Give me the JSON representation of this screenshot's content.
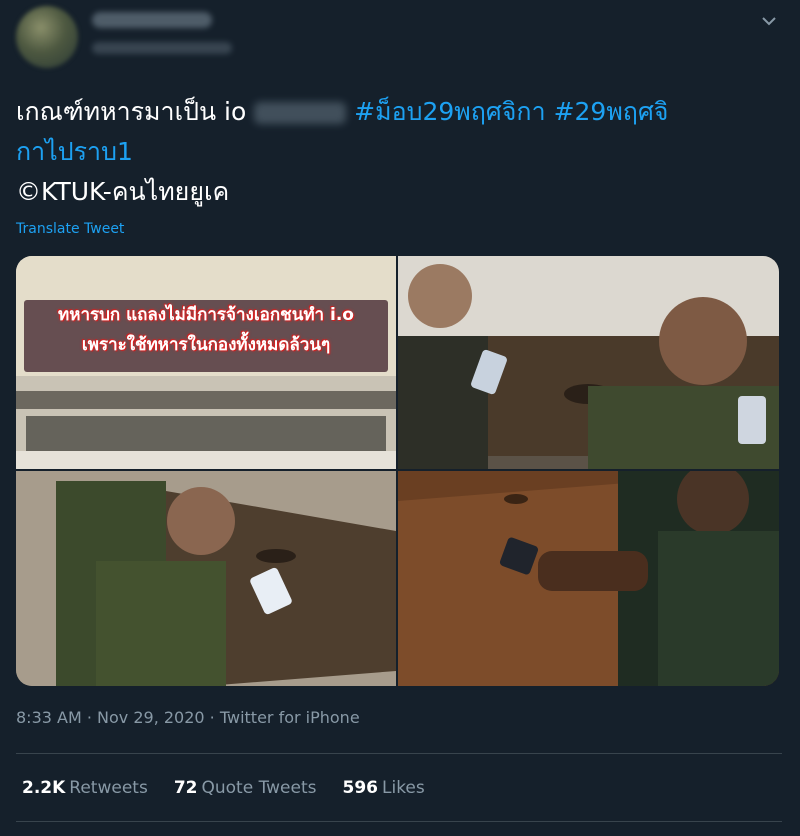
{
  "tweet": {
    "text_main": "เกณฑ์ทหารมาเป็น io",
    "hashtag1": "#ม็อบ29พฤศจิกา",
    "hashtag2_line1": "#29พฤศจิ",
    "hashtag2_line2": "กาไปราบ1",
    "credit": "©KTUK-คนไทยยูเค",
    "translate_label": "Translate Tweet"
  },
  "media": {
    "banner_line1": "ทหารบก แถลงไม่มีการจ้างเอกชนทำ i.o",
    "banner_line2": "เพราะใช้ทหารในกองทั้งหมดล้วนๆ"
  },
  "meta": {
    "time": "8:33 AM",
    "separator": " · ",
    "date": "Nov 29, 2020",
    "source": "Twitter for iPhone"
  },
  "stats": {
    "retweets_count": "2.2K",
    "retweets_label": "Retweets",
    "quotes_count": "72",
    "quotes_label": "Quote Tweets",
    "likes_count": "596",
    "likes_label": "Likes"
  },
  "colors": {
    "background": "#15202b",
    "link": "#1da1f2",
    "secondary_text": "#8899a6",
    "divider": "#38444d"
  },
  "icons": [
    "chevron-down-icon"
  ]
}
